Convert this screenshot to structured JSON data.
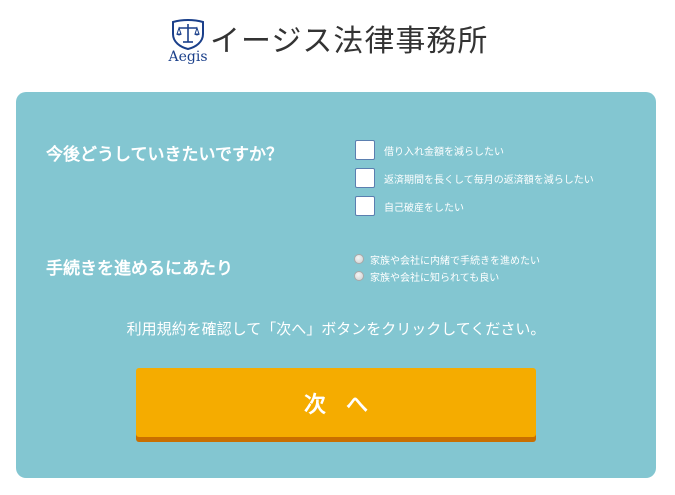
{
  "header": {
    "logo_text": "Aegis",
    "site_title": "イージス法律事務所"
  },
  "form": {
    "question1": {
      "label": "今後どうしていきたいですか？",
      "options": [
        "借り入れ金額を減らしたい",
        "返済期間を長くして毎月の返済額を減らしたい",
        "自己破産をしたい"
      ]
    },
    "question2": {
      "label": "手続きを進めるにあたり",
      "options": [
        "家族や会社に内緒で手続きを進めたい",
        "家族や会社に知られても良い"
      ]
    },
    "notice": "利用規約を確認して「次へ」ボタンをクリックしてください。",
    "next_button": "次へ"
  },
  "colors": {
    "panel": "#83c6d1",
    "button": "#f5ac00",
    "button_shadow": "#c96f00",
    "logo": "#1a3f8a"
  }
}
